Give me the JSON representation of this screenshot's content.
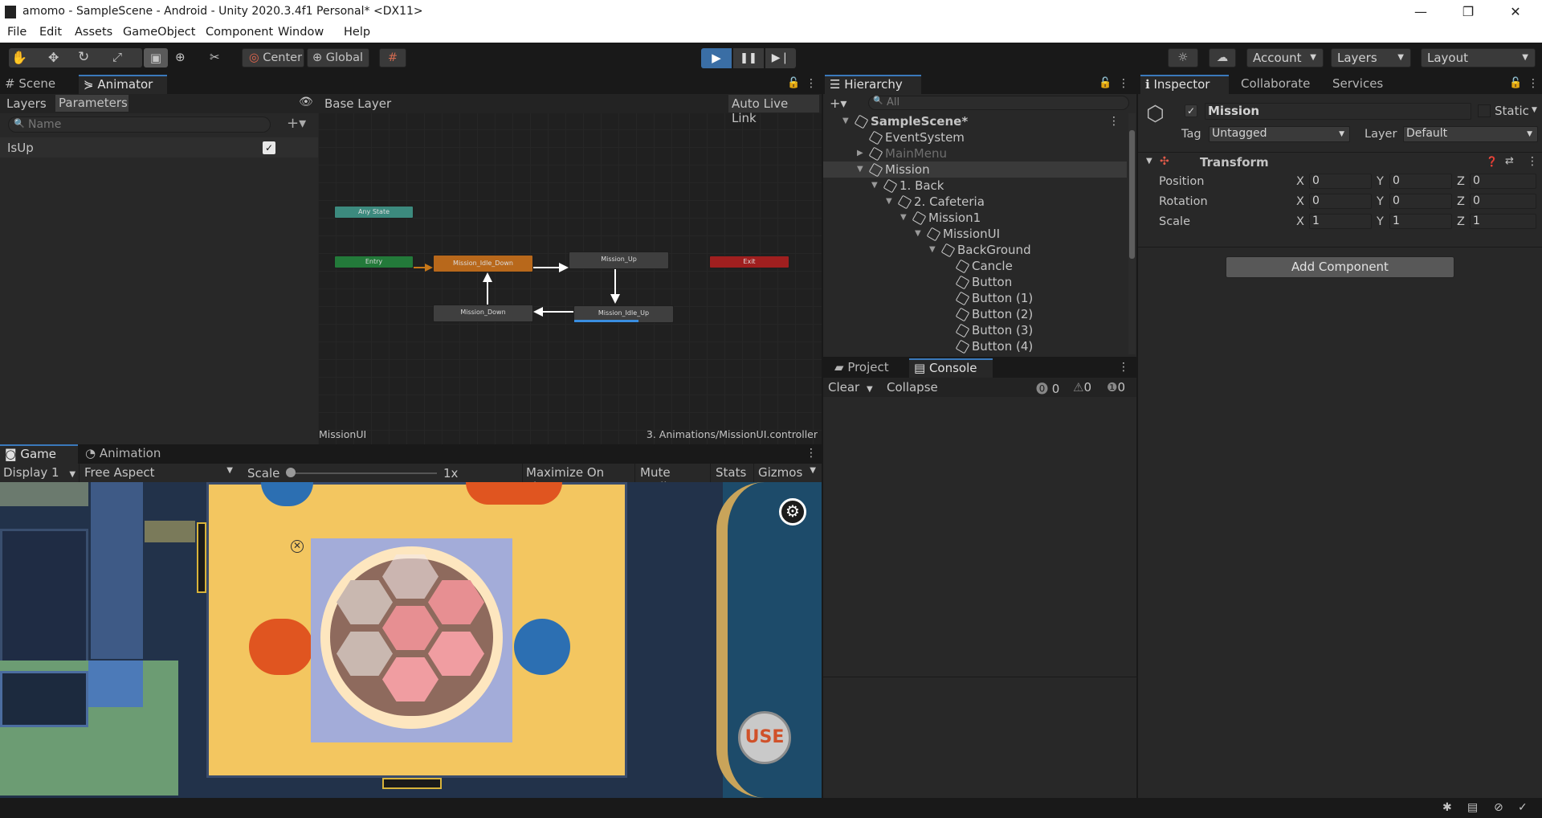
{
  "window": {
    "title": "amomo - SampleScene - Android - Unity 2020.3.4f1 Personal* <DX11>",
    "min": "—",
    "restore": "❐",
    "close": "✕"
  },
  "menu": [
    "File",
    "Edit",
    "Assets",
    "GameObject",
    "Component",
    "Window",
    "Help"
  ],
  "toolbar": {
    "center": "Center",
    "global": "Global",
    "account": "Account",
    "layers": "Layers",
    "layout": "Layout"
  },
  "animator": {
    "tabs": [
      "Scene",
      "Animator"
    ],
    "subtabs": [
      "Layers",
      "Parameters"
    ],
    "search_placeholder": "Name",
    "breadcrumb": "Base Layer",
    "auto_live_link": "Auto Live Link",
    "param_name": "IsUp",
    "param_value": true,
    "footer_left": "MissionUI",
    "footer_right": "3. Animations/MissionUI.controller",
    "states": {
      "any": "Any State",
      "entry": "Entry",
      "exit": "Exit",
      "idle_down": "Mission_Idle_Down",
      "up": "Mission_Up",
      "down": "Mission_Down",
      "idle_up": "Mission_Idle_Up"
    },
    "idle_up_progress": 0.65
  },
  "game": {
    "tabs": [
      "Game",
      "Animation"
    ],
    "display": "Display 1",
    "aspect": "Free Aspect",
    "scale_label": "Scale",
    "scale_value": "1x",
    "toggles": [
      "Maximize On Play",
      "Mute Audio",
      "Stats",
      "Gizmos"
    ],
    "use_label": "USE"
  },
  "hierarchy": {
    "title": "Hierarchy",
    "search_placeholder": "All",
    "items": [
      {
        "name": "SampleScene*",
        "depth": 0
      },
      {
        "name": "EventSystem",
        "depth": 1
      },
      {
        "name": "MainMenu",
        "depth": 1
      },
      {
        "name": "Mission",
        "depth": 1
      },
      {
        "name": "1. Back",
        "depth": 2
      },
      {
        "name": "2. Cafeteria",
        "depth": 3
      },
      {
        "name": "Mission1",
        "depth": 4
      },
      {
        "name": "MissionUI",
        "depth": 5
      },
      {
        "name": "BackGround",
        "depth": 6
      },
      {
        "name": "Cancle",
        "depth": 7
      },
      {
        "name": "Button",
        "depth": 7
      },
      {
        "name": "Button (1)",
        "depth": 7
      },
      {
        "name": "Button (2)",
        "depth": 7
      },
      {
        "name": "Button (3)",
        "depth": 7
      },
      {
        "name": "Button (4)",
        "depth": 7
      }
    ]
  },
  "console": {
    "tabs": [
      "Project",
      "Console"
    ],
    "clear": "Clear",
    "collapse": "Collapse",
    "errors": "0",
    "warnings": "0",
    "logs": "0"
  },
  "inspector": {
    "tabs": [
      "Inspector",
      "Collaborate",
      "Services"
    ],
    "object_name": "Mission",
    "static_label": "Static",
    "tag_label": "Tag",
    "tag_value": "Untagged",
    "layer_label": "Layer",
    "layer_value": "Default",
    "component": "Transform",
    "rows": [
      {
        "label": "Position",
        "x": "0",
        "y": "0",
        "z": "0"
      },
      {
        "label": "Rotation",
        "x": "0",
        "y": "0",
        "z": "0"
      },
      {
        "label": "Scale",
        "x": "1",
        "y": "1",
        "z": "1"
      }
    ],
    "axes": [
      "X",
      "Y",
      "Z"
    ],
    "add_component": "Add Component"
  },
  "colors": {
    "accent": "#3a79bb",
    "play_bg": "#3a6ea5",
    "entry": "#237a3a",
    "exit": "#a01f1f",
    "idle_down": "#b8681b",
    "any": "#3c8a7e"
  }
}
